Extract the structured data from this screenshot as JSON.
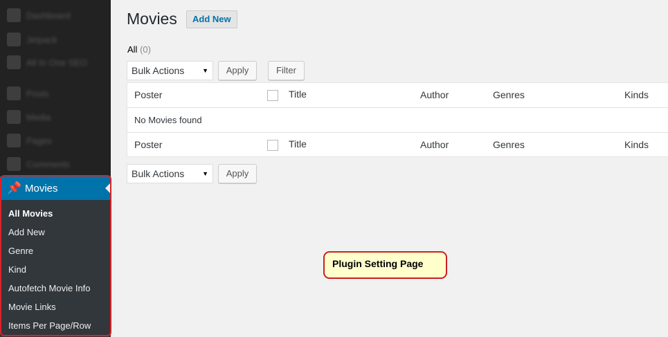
{
  "sidebar": {
    "blurred_items": [
      {
        "label": "Dashboard",
        "icon": "dashboard-icon"
      },
      {
        "label": "Jetpack",
        "icon": "jetpack-icon"
      },
      {
        "label": "All In One SEO",
        "icon": "seo-icon"
      },
      {
        "label": "Posts",
        "icon": "pin-icon"
      },
      {
        "label": "Media",
        "icon": "media-icon"
      },
      {
        "label": "Pages",
        "icon": "page-icon"
      },
      {
        "label": "Comments",
        "icon": "comment-icon"
      }
    ],
    "active_menu": {
      "label": "Movies",
      "icon": "pin-icon"
    },
    "submenu": [
      {
        "label": "All Movies",
        "current": true
      },
      {
        "label": "Add New"
      },
      {
        "label": "Genre"
      },
      {
        "label": "Kind"
      },
      {
        "label": "Autofetch Movie Info"
      },
      {
        "label": "Movie Links"
      },
      {
        "label": "Items Per Page/Row"
      }
    ]
  },
  "main": {
    "title": "Movies",
    "add_new_label": "Add New",
    "filter": {
      "label": "All",
      "count": "(0)"
    },
    "bulk_actions_top": "Bulk Actions",
    "apply_top": "Apply",
    "filter_button": "Filter",
    "bulk_actions_bottom": "Bulk Actions",
    "apply_bottom": "Apply",
    "table": {
      "columns": [
        "Poster",
        "Title",
        "Author",
        "Genres",
        "Kinds"
      ],
      "empty_message": "No Movies found"
    }
  },
  "callout": {
    "text": "Plugin Setting Page"
  },
  "colors": {
    "accent": "#0073aa",
    "sidebar_bg": "#222222",
    "submenu_bg": "#32373c",
    "highlight_border": "#d9222a",
    "callout_bg": "#ffffcc"
  }
}
